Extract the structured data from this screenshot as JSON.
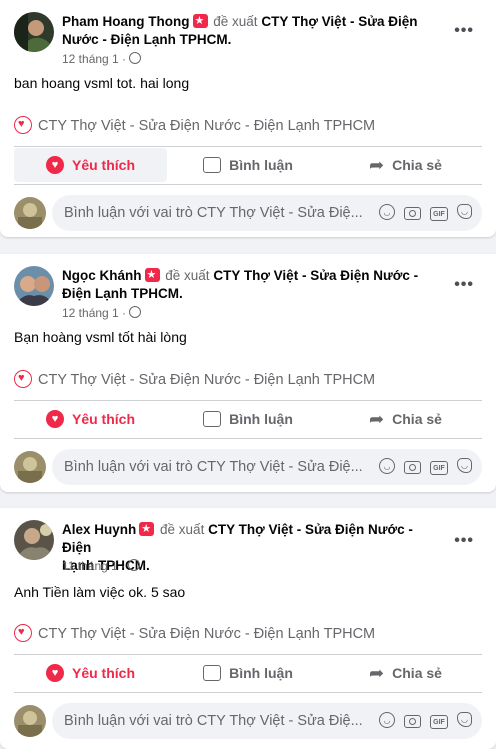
{
  "posts": [
    {
      "author": "Pham Hoang Thong",
      "verb": "đề xuất",
      "page_line1": "CTY Thợ Việt - Sửa Điện",
      "page_line2": "Nước - Điện Lạnh TPHCM.",
      "time": "12 tháng 1 ·",
      "text": "ban hoang vsml tot. hai long",
      "recommendation": "CTY Thợ Việt - Sửa Điện Nước - Điện Lạnh TPHCM"
    },
    {
      "author": "Ngọc Khánh",
      "verb": "đề xuất",
      "page_line1": "CTY Thợ Việt - Sửa Điện Nước -",
      "page_line2": "Điện Lạnh TPHCM.",
      "time": "12 tháng 1 ·",
      "text": "Bạn hoàng vsml tốt hài lòng",
      "recommendation": "CTY Thợ Việt - Sửa Điện Nước - Điện Lạnh TPHCM"
    },
    {
      "author": "Alex Huynh",
      "verb": "đề xuất",
      "page_line1": "CTY Thợ Việt - Sửa Điện Nước - Điện",
      "page_line2": "Lạnh TPHCM.",
      "time": "11 tháng 1 ·",
      "text": "Anh Tiền làm việc ok. 5 sao",
      "recommendation": "CTY Thợ Việt - Sửa Điện Nước - Điện Lạnh TPHCM"
    }
  ],
  "actions": {
    "like": "Yêu thích",
    "comment": "Bình luận",
    "share": "Chia sẻ"
  },
  "comment_placeholder": "Bình luận với vai trò CTY Thợ Việt - Sửa Điệ...",
  "icons": {
    "more": "more-horizontal-icon",
    "like": "heart-icon",
    "comment": "comment-bubble-icon",
    "share": "share-arrow-icon",
    "emoji": "smile-icon",
    "camera": "camera-icon",
    "gif": "gif-icon",
    "sticker": "sticker-icon"
  },
  "gif_label": "GIF",
  "colors": {
    "accent": "#f02849",
    "muted": "#65676b",
    "background": "#f0f2f5"
  }
}
